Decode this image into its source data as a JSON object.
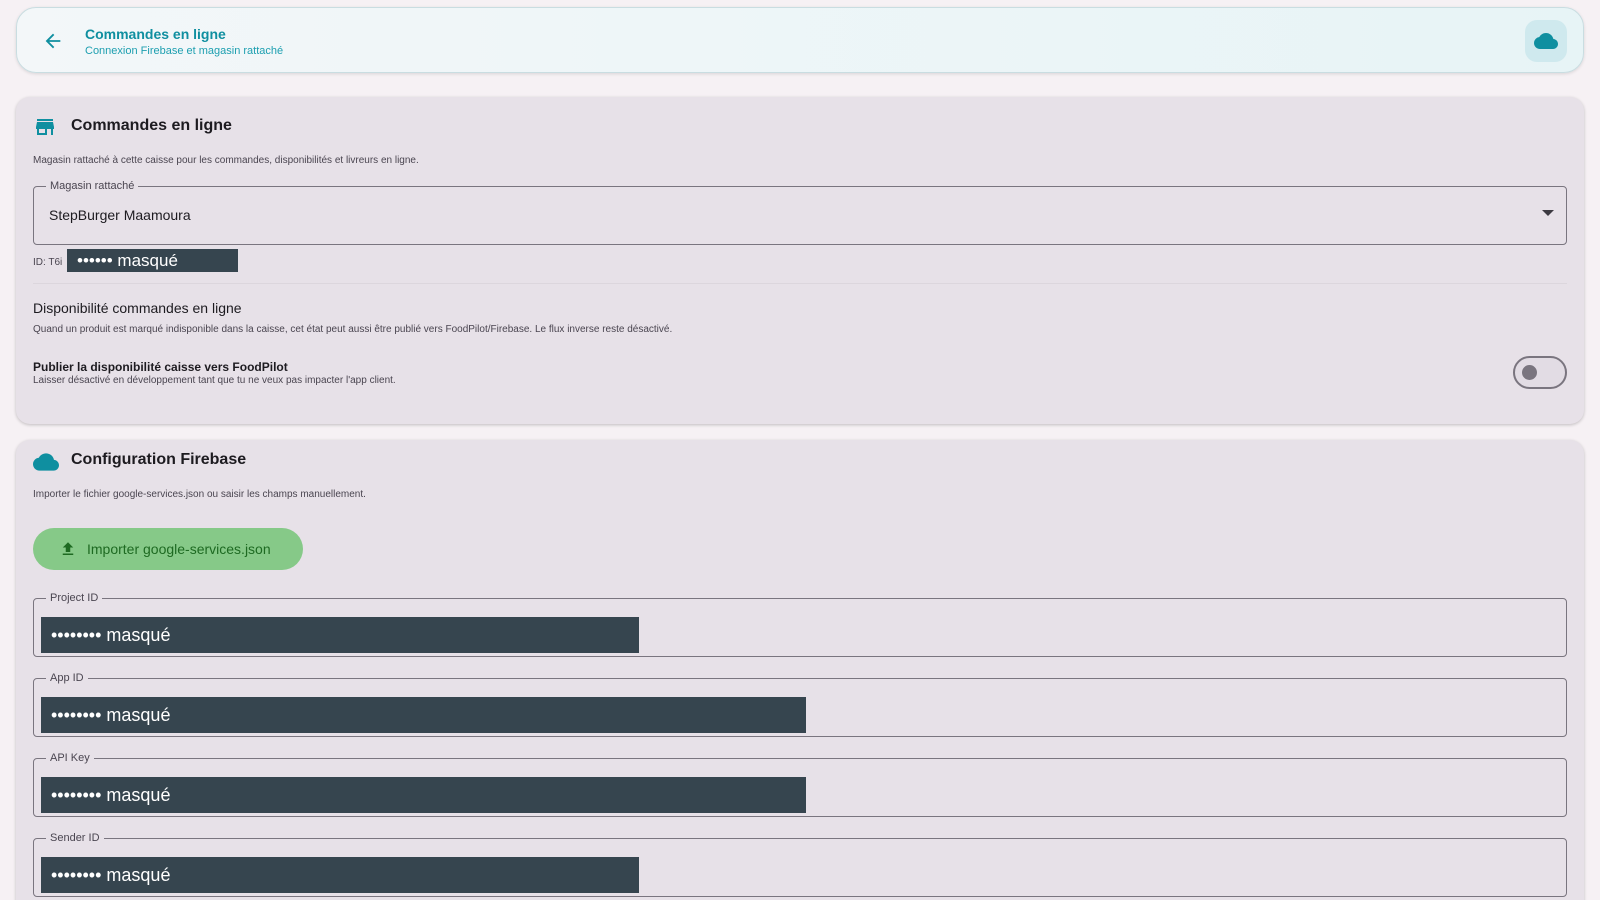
{
  "header": {
    "title": "Commandes en ligne",
    "subtitle": "Connexion Firebase et magasin rattaché"
  },
  "online_orders": {
    "title": "Commandes en ligne",
    "description": "Magasin rattaché à cette caisse pour les commandes, disponibilités et livreurs en ligne.",
    "store_field": {
      "label": "Magasin rattaché",
      "value": "StepBurger Maamoura"
    },
    "id_label": "ID: T6i",
    "id_mask": "•••••• masqué",
    "availability": {
      "title": "Disponibilité commandes en ligne",
      "description": "Quand un produit est marqué indisponible dans la caisse, cet état peut aussi être publié vers FoodPilot/Firebase. Le flux inverse reste désactivé.",
      "toggle_title": "Publier la disponibilité caisse vers FoodPilot",
      "toggle_description": "Laisser désactivé en développement tant que tu ne veux pas impacter l'app client.",
      "enabled": false
    }
  },
  "firebase": {
    "title": "Configuration Firebase",
    "description": "Importer le fichier google-services.json ou saisir les champs manuellement.",
    "import_label": "Importer google-services.json",
    "fields": [
      {
        "label": "Project ID",
        "value": "•••••••• masqué"
      },
      {
        "label": "App ID",
        "value": "•••••••• masqué"
      },
      {
        "label": "API Key",
        "value": "•••••••• masqué"
      },
      {
        "label": "Sender ID",
        "value": "•••••••• masqué"
      }
    ]
  },
  "colors": {
    "accent": "#0f8fa0",
    "card_bg": "#e7e1e8",
    "mask_bg": "#36454f",
    "import_button_bg": "#86c988"
  },
  "icons": {
    "back": "arrow-back-icon",
    "header_action": "cloud-icon",
    "store": "storefront-icon",
    "firebase": "cloud-icon",
    "import": "upload-icon",
    "dropdown": "arrow-drop-down-icon"
  }
}
